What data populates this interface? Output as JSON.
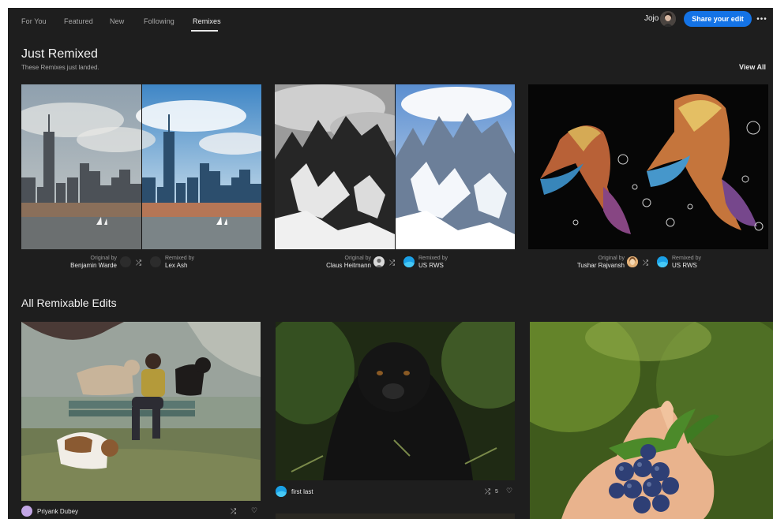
{
  "nav": {
    "tabs": [
      {
        "label": "For You"
      },
      {
        "label": "Featured"
      },
      {
        "label": "New"
      },
      {
        "label": "Following"
      },
      {
        "label": "Remixes"
      }
    ],
    "active_tab": "Remixes",
    "user_name": "Jojo",
    "share_label": "Share your edit",
    "more_label": "•••"
  },
  "just_remixed": {
    "title": "Just Remixed",
    "subtitle": "These Remixes just landed.",
    "view_all": "View All",
    "cards": [
      {
        "original_label": "Original by",
        "original_name": "Benjamin Warde",
        "remixed_label": "Remixed by",
        "remixed_name": "Lex Ash"
      },
      {
        "original_label": "Original by",
        "original_name": "Claus Heitmann",
        "remixed_label": "Remixed by",
        "remixed_name": "US RWS"
      },
      {
        "original_label": "Original by",
        "original_name": "Tushar Rajvansh",
        "remixed_label": "Remixed by",
        "remixed_name": "US RWS"
      }
    ]
  },
  "all_remixable": {
    "title": "All Remixable Edits",
    "items": [
      {
        "author": "Priyank Dubey"
      },
      {
        "author": "first last",
        "remix_count": "5"
      },
      {
        "author": ""
      }
    ]
  },
  "icons": {
    "remix": "remix-icon",
    "heart": "heart-icon",
    "more": "more-icon"
  },
  "colors": {
    "background": "#1e1e1e",
    "accent": "#1473e6",
    "text": "#e8e8e8",
    "muted": "#a9a9a9"
  }
}
